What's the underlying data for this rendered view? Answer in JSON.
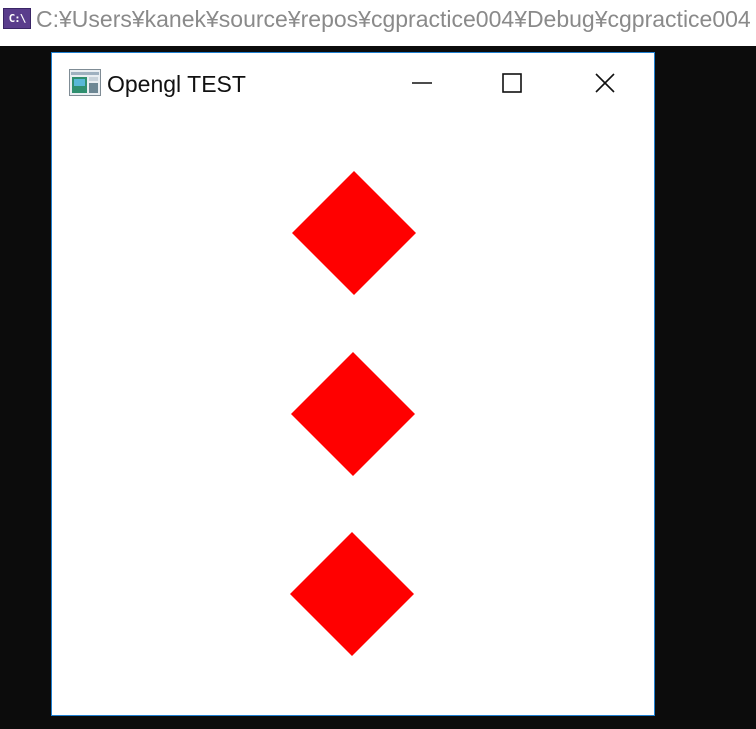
{
  "console_window": {
    "icon_label": "C:\\",
    "title": "C:¥Users¥kanek¥source¥repos¥cgpractice004¥Debug¥cgpractice004"
  },
  "gl_window": {
    "title": "Opengl TEST",
    "controls": {
      "minimize_icon": "minimize-icon",
      "maximize_icon": "maximize-icon",
      "close_icon": "close-icon"
    },
    "shapes": [
      {
        "type": "diamond",
        "color": "#ff0000"
      },
      {
        "type": "diamond",
        "color": "#ff0000"
      },
      {
        "type": "diamond",
        "color": "#ff0000"
      }
    ]
  }
}
